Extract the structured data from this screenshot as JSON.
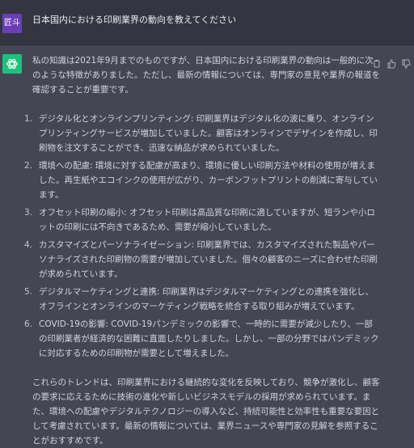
{
  "user": {
    "avatar_label": "匠斗",
    "message": "日本国内における印刷業界の動向を教えてください"
  },
  "assistant": {
    "intro": "私の知識は2021年9月までのものですが、日本国内における印刷業界の動向は一般的に次のような特徴がありました。ただし、最新の情報については、専門家の意見や業界の報道を確認することが重要です。",
    "items": [
      {
        "num": "1.",
        "text": "デジタル化とオンラインプリンティング: 印刷業界はデジタル化の波に乗り、オンラインプリンティングサービスが増加していました。顧客はオンラインでデザインを作成し、印刷物を注文することができ、迅速な納品が求められていました。"
      },
      {
        "num": "2.",
        "text": "環境への配慮: 環境に対する配慮が高まり、環境に優しい印刷方法や材料の使用が増えました。再生紙やエコインクの使用が広がり、カーボンフットプリントの削減に寄与しています。"
      },
      {
        "num": "3.",
        "text": "オフセット印刷の縮小: オフセット印刷は高品質な印刷に適していますが、短ランや小ロットの印刷には不向きであるため、需要が縮小していました。"
      },
      {
        "num": "4.",
        "text": "カスタマイズとパーソナライゼーション: 印刷業界では、カスタマイズされた製品やパーソナライズされた印刷物の需要が増加していました。個々の顧客のニーズに合わせた印刷が求められています。"
      },
      {
        "num": "5.",
        "text": "デジタルマーケティングと連携: 印刷業界はデジタルマーケティングとの連携を強化し、オフラインとオンラインのマーケティング戦略を統合する取り組みが増えています。"
      },
      {
        "num": "6.",
        "text": "COVID-19の影響: COVID-19パンデミックの影響で、一時的に需要が減少したり、一部の印刷業者が経済的な困難に直面したりしました。しかし、一部の分野ではパンデミックに対応するための印刷物が需要として増えました。"
      }
    ],
    "outro": "これらのトレンドは、印刷業界における継続的な変化を反映しており、競争が激化し、顧客の要求に応えるために技術の進化や新しいビジネスモデルの採用が求められています。また、環境への配慮やデジタルテクノロジーの導入など、持続可能性と効率性も重要な要因として考慮されています。最新の情報については、業界ニュースや専門家の見解を参照することがおすすめです。"
  },
  "icons": {
    "assistant_avatar": "openai-logo-icon",
    "copy": "clipboard-icon",
    "like": "thumbs-up-icon",
    "dislike": "thumbs-down-icon"
  },
  "colors": {
    "user_bg": "#343541",
    "assistant_bg": "#444654",
    "avatar_user": "#6a3fb5",
    "avatar_gpt": "#19c37d"
  }
}
